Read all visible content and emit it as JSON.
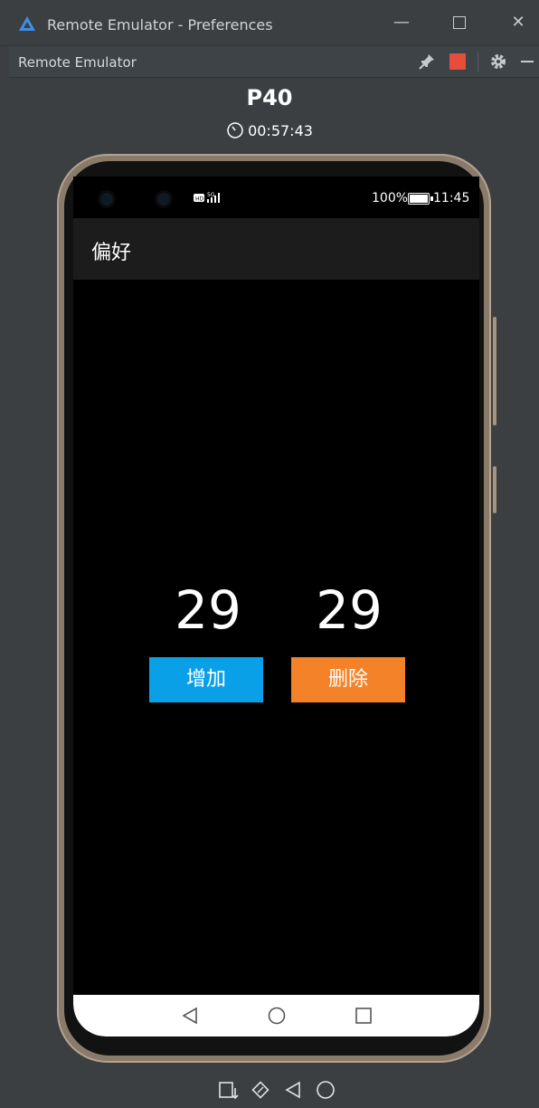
{
  "window": {
    "title": "Remote Emulator - Preferences",
    "controls": [
      "minimize",
      "maximize",
      "close"
    ]
  },
  "toolwindow": {
    "title": "Remote Emulator",
    "icons": [
      "pin-icon",
      "stop-icon",
      "gear-icon",
      "hide-icon"
    ],
    "stop_color": "#e74c3c"
  },
  "device": {
    "name": "P40",
    "timer": "00:57:43"
  },
  "phone": {
    "status": {
      "network": "5G",
      "battery": "100%",
      "time": "11:45"
    },
    "app": {
      "title": "偏好",
      "counter_left": "29",
      "counter_right": "29",
      "add_label": "增加",
      "delete_label": "删除",
      "add_color": "#0aa0e8",
      "delete_color": "#f48228"
    },
    "navbar": [
      "back-icon",
      "home-icon",
      "recent-apps-icon"
    ]
  },
  "bottom_controls": [
    "screenshot-icon",
    "rotate-icon",
    "back-icon",
    "home-icon"
  ]
}
